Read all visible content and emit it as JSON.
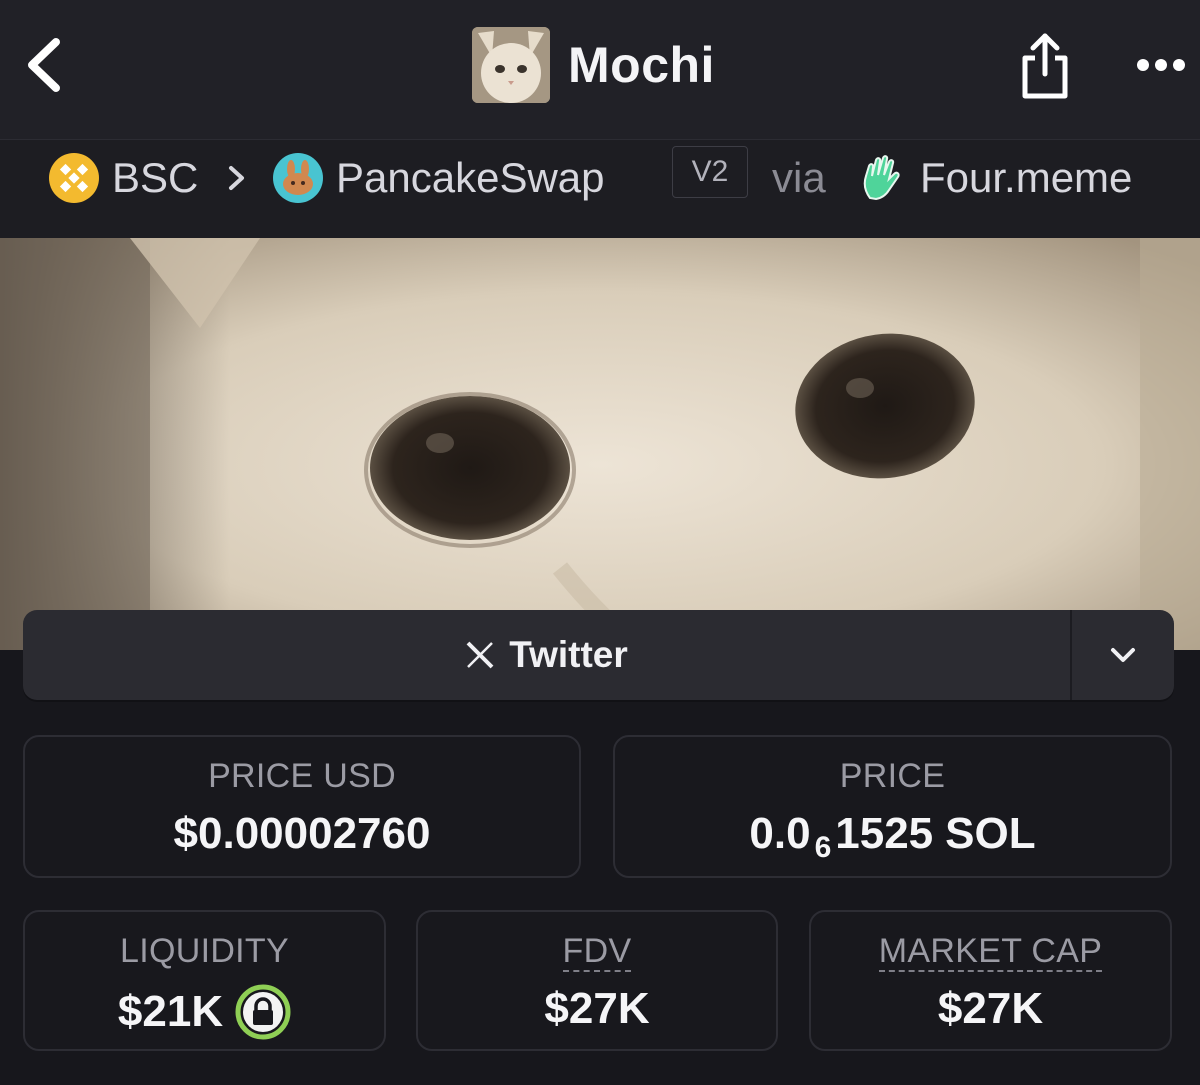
{
  "header": {
    "title": "Mochi",
    "back_icon": "chevron-left-icon",
    "share_icon": "share-icon",
    "more_icon": "more-horizontal-icon"
  },
  "breadcrumb": {
    "chain": "BSC",
    "separator": ">",
    "dex": "PancakeSwap",
    "version": "V2",
    "via": "via",
    "launchpad": "Four.meme"
  },
  "social": {
    "twitter_label": "Twitter",
    "twitter_icon": "x-logo-icon",
    "toggle_icon": "chevron-down-icon"
  },
  "stats": {
    "price_usd": {
      "label": "PRICE USD",
      "value": "$0.00002760"
    },
    "price_native": {
      "label": "PRICE",
      "value_prefix": "0.0",
      "value_subscript": "6",
      "value_digits": "1525",
      "value_unit": "SOL"
    },
    "liquidity": {
      "label": "LIQUIDITY",
      "value": "$21K",
      "icon": "lock-icon"
    },
    "fdv": {
      "label": "FDV",
      "value": "$27K"
    },
    "market_cap": {
      "label": "MARKET CAP",
      "value": "$27K"
    }
  },
  "colors": {
    "background": "#17171c",
    "header": "#212127",
    "card_border": "#2d2d34",
    "lock_green": "#8fcf55",
    "bsc_yellow": "#f3ba2f",
    "pancake_blue": "#49c4d1"
  }
}
